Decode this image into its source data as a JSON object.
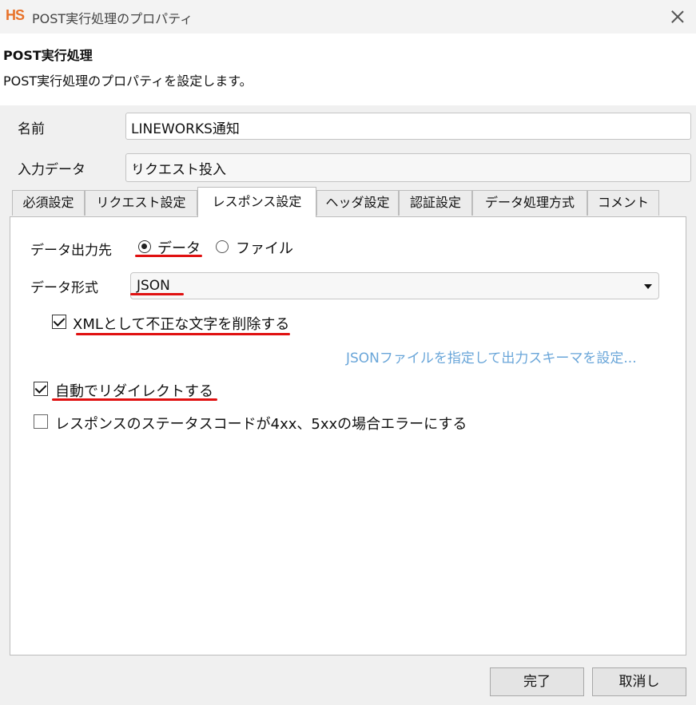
{
  "window": {
    "logo": "HS",
    "title": "POST実行処理のプロパティ"
  },
  "header": {
    "title": "POST実行処理",
    "description": "POST実行処理のプロパティを設定します。"
  },
  "form": {
    "name_label": "名前",
    "name_value": "LINEWORKS通知",
    "input_label": "入力データ",
    "input_value": "リクエスト投入"
  },
  "tabs": [
    {
      "label": "必須設定",
      "active": false
    },
    {
      "label": "リクエスト設定",
      "active": false
    },
    {
      "label": "レスポンス設定",
      "active": true
    },
    {
      "label": "ヘッダ設定",
      "active": false
    },
    {
      "label": "認証設定",
      "active": false
    },
    {
      "label": "データ処理方式",
      "active": false
    },
    {
      "label": "コメント",
      "active": false
    }
  ],
  "panel": {
    "output_label": "データ出力先",
    "output_options": [
      {
        "label": "データ",
        "selected": true
      },
      {
        "label": "ファイル",
        "selected": false
      }
    ],
    "format_label": "データ形式",
    "format_value": "JSON",
    "xml_checkbox": {
      "label": "XMLとして不正な文字を削除する",
      "checked": true
    },
    "schema_link": "JSONファイルを指定して出力スキーマを設定...",
    "redirect_checkbox": {
      "label": "自動でリダイレクトする",
      "checked": true
    },
    "error_checkbox": {
      "label": "レスポンスのステータスコードが4xx、5xxの場合エラーにする",
      "checked": false
    }
  },
  "buttons": {
    "ok": "完了",
    "cancel": "取消し"
  },
  "colors": {
    "logo": "#e8722a",
    "highlight_underline": "#e01010",
    "link": "#6aa6d9"
  }
}
